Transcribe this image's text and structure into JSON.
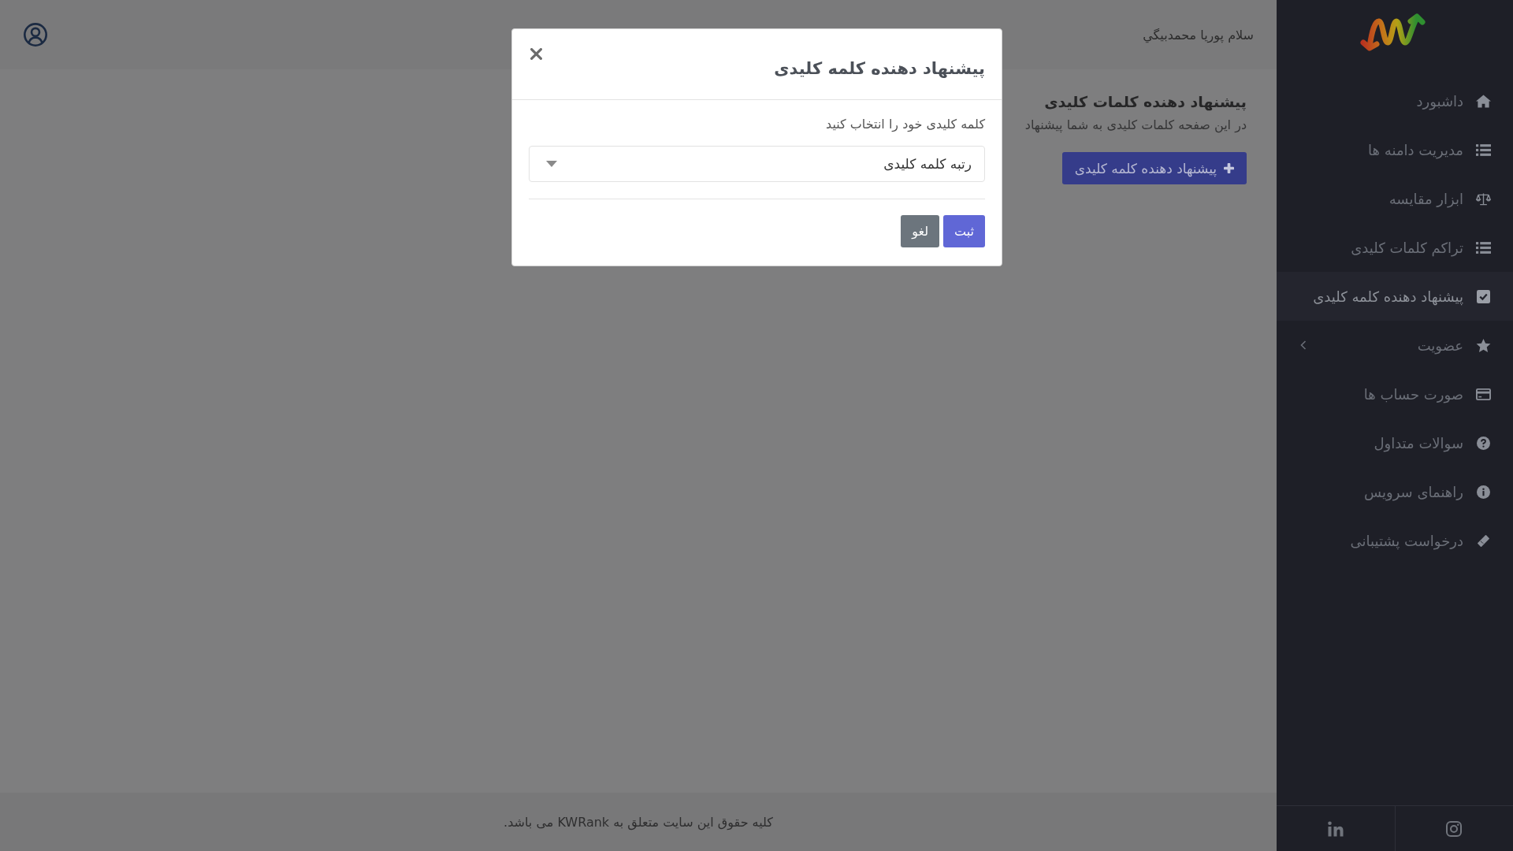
{
  "sidebar": {
    "items": [
      {
        "label": "داشبورد",
        "kind": "link",
        "selected": false
      },
      {
        "label": "مدیریت دامنه ها",
        "kind": "link",
        "selected": false
      },
      {
        "label": "ابزار مقایسه",
        "kind": "link",
        "selected": false
      },
      {
        "label": "تراکم کلمات کلیدی",
        "kind": "link",
        "selected": false
      },
      {
        "label": "پیشنهاد دهنده کلمه کلیدی",
        "kind": "link",
        "selected": true
      },
      {
        "label": "عضویت",
        "kind": "group",
        "selected": false,
        "expanded": false
      },
      {
        "label": "صورت حساب ها",
        "kind": "link",
        "selected": false
      },
      {
        "label": "سوالات متداول",
        "kind": "link",
        "selected": false
      },
      {
        "label": "راهنمای سرویس",
        "kind": "link",
        "selected": false
      },
      {
        "label": "درخواست پشتیبانی",
        "kind": "link",
        "selected": false
      }
    ]
  },
  "header": {
    "greeting": "سلام پوریا محمدبیگي"
  },
  "page": {
    "title": "پیشنهاد دهنده کلمات کلیدی",
    "description": "در این صفحه کلمات کلیدی به شما پیشنهاد",
    "add_button": "پیشنهاد دهنده کلمه کلیدی"
  },
  "modal": {
    "title": "پیشنهاد دهنده کلمه کلیدی",
    "field_label": "کلمه کلیدی خود را انتخاب کنید",
    "keyword_select": {
      "value": "رتبه کلمه کلیدی"
    },
    "buttons": [
      {
        "label": "ثبت",
        "kind": "primary"
      },
      {
        "label": "لغو",
        "kind": "secondary"
      }
    ]
  },
  "footer": {
    "text": "کلیه حقوق این سایت متعلق به KWRank می باشد."
  }
}
